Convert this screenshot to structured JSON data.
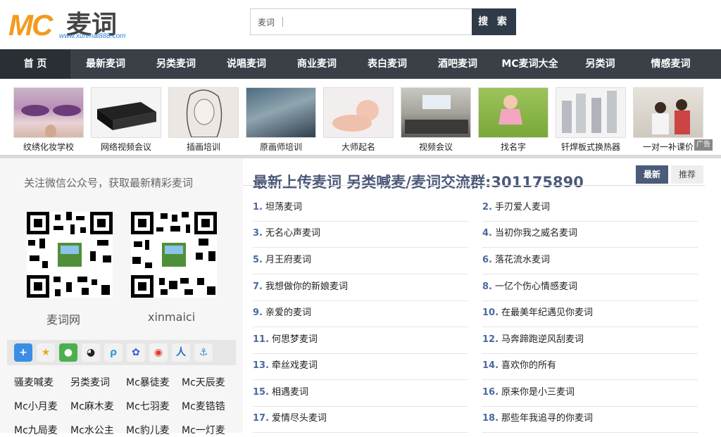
{
  "logo": {
    "mc": "MC",
    "cn": "麦词",
    "url": "www.xunmai888.com"
  },
  "search": {
    "value": "麦词",
    "button": "搜 索"
  },
  "nav": [
    "首 页",
    "最新麦词",
    "另类麦词",
    "说唱麦词",
    "商业麦词",
    "表白麦词",
    "酒吧麦词",
    "MC麦词大全",
    "另类词",
    "情感麦词"
  ],
  "ads": [
    {
      "caption": "纹绣化妆学校",
      "icon": "eye-makeup-photo"
    },
    {
      "caption": "网络视频会议",
      "icon": "video-device-photo"
    },
    {
      "caption": "插画培训",
      "icon": "sketch-girl-photo"
    },
    {
      "caption": "原画师培训",
      "icon": "fantasy-art-photo"
    },
    {
      "caption": "大师起名",
      "icon": "baby-photo"
    },
    {
      "caption": "视频会议",
      "icon": "conference-room-photo"
    },
    {
      "caption": "找名字",
      "icon": "toddler-photo"
    },
    {
      "caption": "钎焊板式换热器",
      "icon": "heat-exchanger-photo"
    },
    {
      "caption": "一对一补课价",
      "icon": "tutoring-photo"
    }
  ],
  "ad_tag": "广告",
  "sidebar": {
    "follow_text": "关注微信公众号，获取最新精彩麦词",
    "qr_labels": [
      "麦词网",
      "xinmaici"
    ],
    "share_icons": [
      "plus-icon",
      "star-icon",
      "wechat-icon",
      "qq-icon",
      "pinyin-icon",
      "baidu-icon",
      "weibo-icon",
      "renren-icon",
      "qzone-icon"
    ],
    "links": [
      "骚麦喊麦",
      "另类麦词",
      "Mc暴徒麦",
      "Mc天辰麦",
      "Mc小月麦",
      "Mc麻木麦",
      "Mc七羽麦",
      "Mc麦锆锆",
      "Mc九局麦",
      "Mc水公主",
      "Mc豹儿麦",
      "Mc一灯麦"
    ]
  },
  "main": {
    "title": "最新上传麦词   另类喊麦/麦词交流群:301175890",
    "tabs": [
      "最新",
      "推荐"
    ],
    "items": [
      {
        "num": "1.",
        "text": "坦荡麦词"
      },
      {
        "num": "2.",
        "text": "手刃爱人麦词"
      },
      {
        "num": "3.",
        "text": "无名心声麦词"
      },
      {
        "num": "4.",
        "text": "当初你我之威名麦词"
      },
      {
        "num": "5.",
        "text": "月王府麦词"
      },
      {
        "num": "6.",
        "text": "落花流水麦词"
      },
      {
        "num": "7.",
        "text": "我想做你的新娘麦词"
      },
      {
        "num": "8.",
        "text": "一亿个伤心情感麦词"
      },
      {
        "num": "9.",
        "text": "亲爱的麦词"
      },
      {
        "num": "10.",
        "text": "在最美年纪遇见你麦词"
      },
      {
        "num": "11.",
        "text": "何思梦麦词"
      },
      {
        "num": "12.",
        "text": "马奔蹄跑逆风刮麦词"
      },
      {
        "num": "13.",
        "text": "牵丝戏麦词"
      },
      {
        "num": "14.",
        "text": "喜欢你的所有"
      },
      {
        "num": "15.",
        "text": "相遇麦词"
      },
      {
        "num": "16.",
        "text": "原来你是小三麦词"
      },
      {
        "num": "17.",
        "text": "爱情尽头麦词"
      },
      {
        "num": "18.",
        "text": "那些年我追寻的你麦词"
      }
    ]
  },
  "colors": {
    "accent": "#f39a1e",
    "nav_bg": "#3a3f48",
    "title": "#4a5878",
    "search_btn": "#2f3b48"
  }
}
